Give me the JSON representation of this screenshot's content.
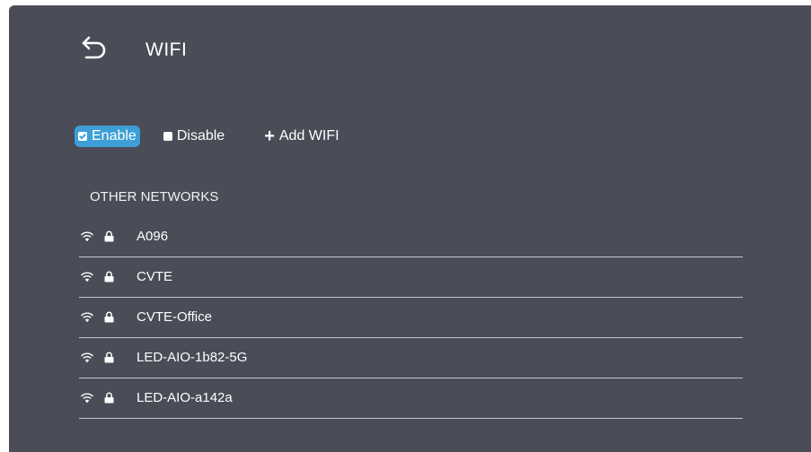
{
  "header": {
    "back_icon": "back-arrow-icon",
    "title": "WIFI"
  },
  "options": {
    "enable_label": "Enable",
    "enable_checked": true,
    "disable_label": "Disable",
    "disable_checked": false,
    "add_label": "Add WIFI",
    "add_symbol": "+",
    "accent_color": "#3d9fd6"
  },
  "networks": {
    "section_title": "OTHER NETWORKS",
    "items": [
      {
        "name": "A096",
        "secured": true,
        "icon": "wifi-icon"
      },
      {
        "name": "CVTE",
        "secured": true,
        "icon": "wifi-icon"
      },
      {
        "name": "CVTE-Office",
        "secured": true,
        "icon": "wifi-icon"
      },
      {
        "name": "LED-AIO-1b82-5G",
        "secured": true,
        "icon": "wifi-icon"
      },
      {
        "name": "LED-AIO-a142a",
        "secured": true,
        "icon": "wifi-icon"
      }
    ]
  },
  "colors": {
    "panel_bg": "#4a4c57",
    "divider": "#c4c5cb"
  }
}
